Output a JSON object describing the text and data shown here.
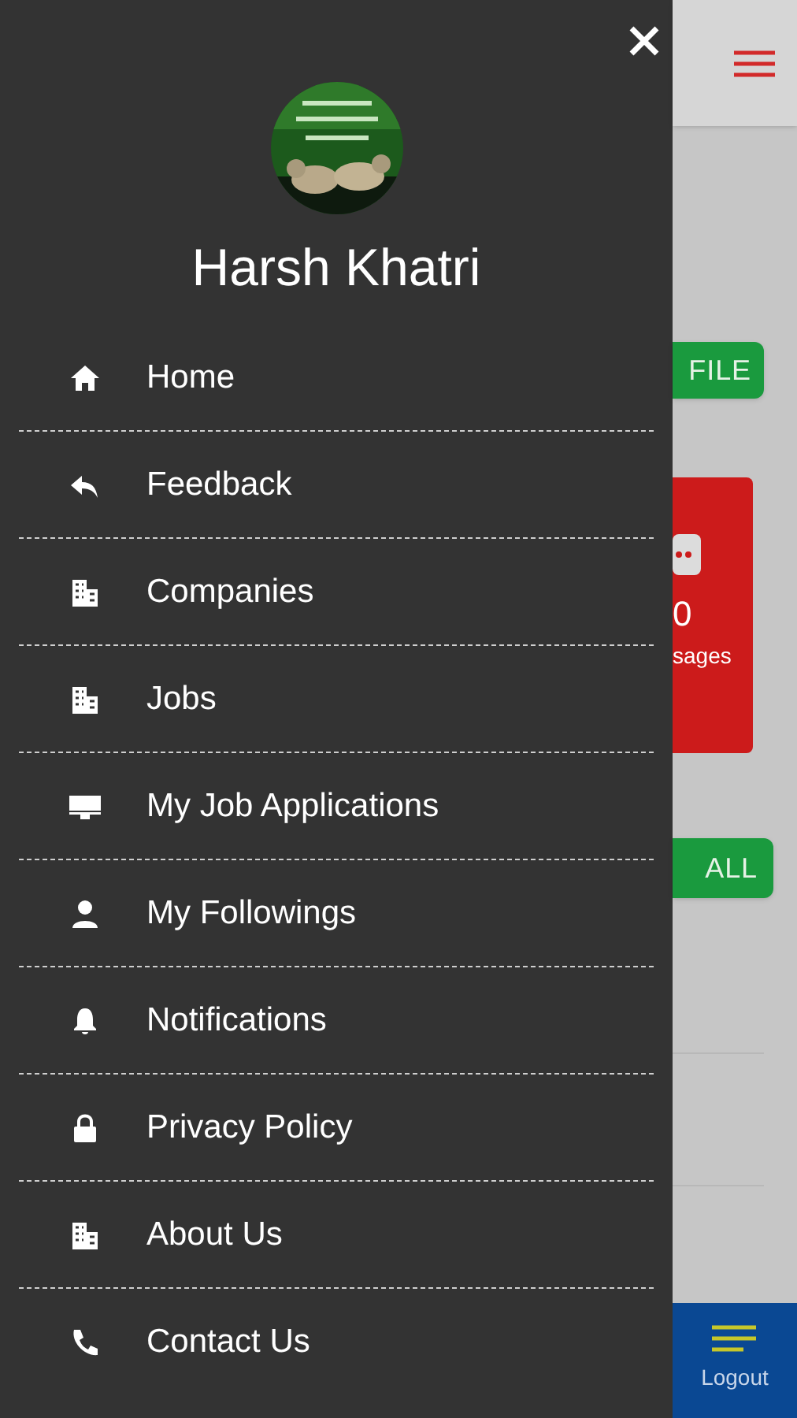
{
  "drawer": {
    "user_name": "Harsh Khatri",
    "items": [
      {
        "label": "Home"
      },
      {
        "label": "Feedback"
      },
      {
        "label": "Companies"
      },
      {
        "label": "Jobs"
      },
      {
        "label": "My Job Applications"
      },
      {
        "label": "My Followings"
      },
      {
        "label": "Notifications"
      },
      {
        "label": "Privacy Policy"
      },
      {
        "label": "About Us"
      },
      {
        "label": "Contact Us"
      }
    ]
  },
  "background": {
    "profile_button": "FILE",
    "card": {
      "count": "0",
      "caption": "sages"
    },
    "view_all_button": "ALL",
    "bottom_nav": {
      "label": "Logout"
    }
  }
}
